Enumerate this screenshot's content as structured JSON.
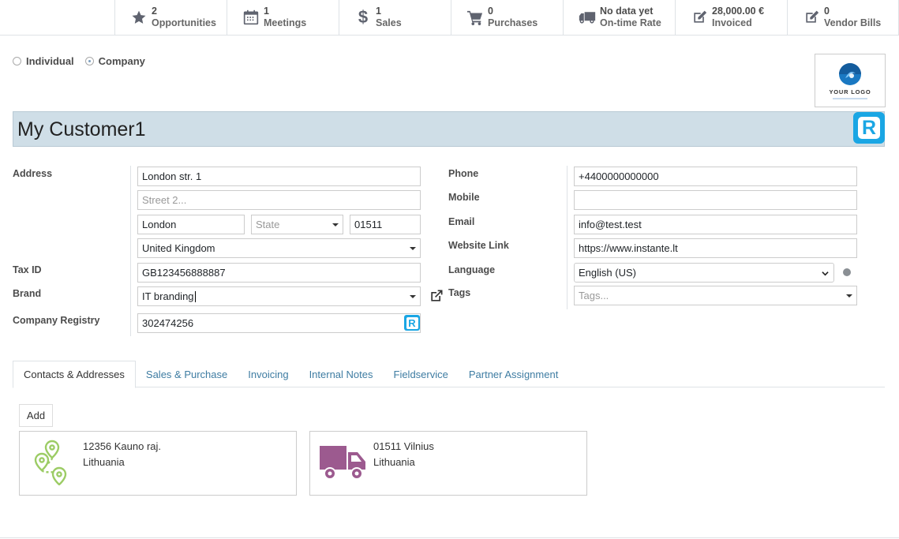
{
  "stats": [
    {
      "icon": "star-icon",
      "value": "2",
      "label": "Opportunities"
    },
    {
      "icon": "calendar-icon",
      "value": "1",
      "label": "Meetings"
    },
    {
      "icon": "dollar-icon",
      "value": "1",
      "label": "Sales"
    },
    {
      "icon": "cart-icon",
      "value": "0",
      "label": "Purchases"
    },
    {
      "icon": "truck-icon",
      "value": "No data yet",
      "label": "On-time Rate"
    },
    {
      "icon": "edit-icon",
      "value": "28,000.00 €",
      "label": "Invoiced"
    },
    {
      "icon": "edit-icon",
      "value": "0",
      "label": "Vendor Bills"
    }
  ],
  "company_type": {
    "individual": "Individual",
    "company": "Company",
    "selected": "Company"
  },
  "logo": {
    "text": "YOUR LOGO",
    "color": "#1a78c2"
  },
  "name": "My Customer1",
  "labels": {
    "address": "Address",
    "tax_id": "Tax ID",
    "brand": "Brand",
    "company_registry": "Company Registry",
    "phone": "Phone",
    "mobile": "Mobile",
    "email": "Email",
    "website": "Website Link",
    "language": "Language",
    "tags": "Tags"
  },
  "fields": {
    "street": "London str. 1",
    "street2_placeholder": "Street 2...",
    "city": "London",
    "state_placeholder": "State",
    "zip": "01511",
    "country": "United Kingdom",
    "tax_id": "GB123456888887",
    "brand": "IT branding",
    "company_registry": "302474256",
    "phone": "+4400000000000",
    "mobile": "",
    "email": "info@test.test",
    "website": "https://www.instante.lt",
    "language": "English (US)",
    "tags_placeholder": "Tags..."
  },
  "tabs": [
    "Contacts & Addresses",
    "Sales & Purchase",
    "Invoicing",
    "Internal Notes",
    "Fieldservice",
    "Partner Assignment"
  ],
  "active_tab": "Contacts & Addresses",
  "add_label": "Add",
  "cards": [
    {
      "icon": "map-route-icon",
      "line1": "12356 Kauno raj.",
      "line2": "Lithuania",
      "color": "#9ccc65"
    },
    {
      "icon": "truck-icon",
      "line1": "01511 Vilnius",
      "line2": "Lithuania",
      "color": "#9c5a8f"
    }
  ],
  "colors": {
    "name_bar": "#cfdee7",
    "accent_blue": "#1aa6e4",
    "tab_link": "#3e7ca2"
  }
}
